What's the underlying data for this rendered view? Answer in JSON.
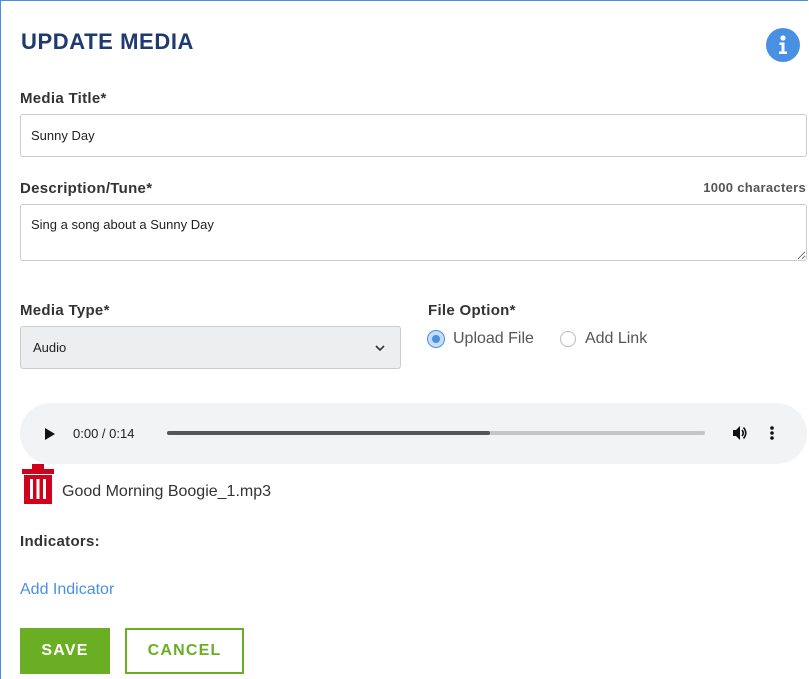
{
  "form": {
    "title": "UPDATE MEDIA",
    "media_title": {
      "label": "Media Title*",
      "value": "Sunny Day"
    },
    "description": {
      "label": "Description/Tune*",
      "char_limit": "1000 characters",
      "value": "Sing a song about a Sunny Day"
    },
    "media_type": {
      "label": "Media Type*",
      "selected": "Audio"
    },
    "file_option": {
      "label": "File Option*",
      "options": [
        "Upload File",
        "Add Link"
      ],
      "selected": "Upload File"
    },
    "audio": {
      "time": "0:00 / 0:14",
      "progress": 0.6
    },
    "file": {
      "name": "Good Morning Boogie_1.mp3"
    },
    "indicators": {
      "label": "Indicators:",
      "add_link": "Add Indicator"
    },
    "buttons": {
      "save": "SAVE",
      "cancel": "CANCEL"
    }
  },
  "colors": {
    "title": "#1f3a6e",
    "accent": "#4a90e2",
    "save": "#6aae24",
    "trash": "#d0021b"
  }
}
